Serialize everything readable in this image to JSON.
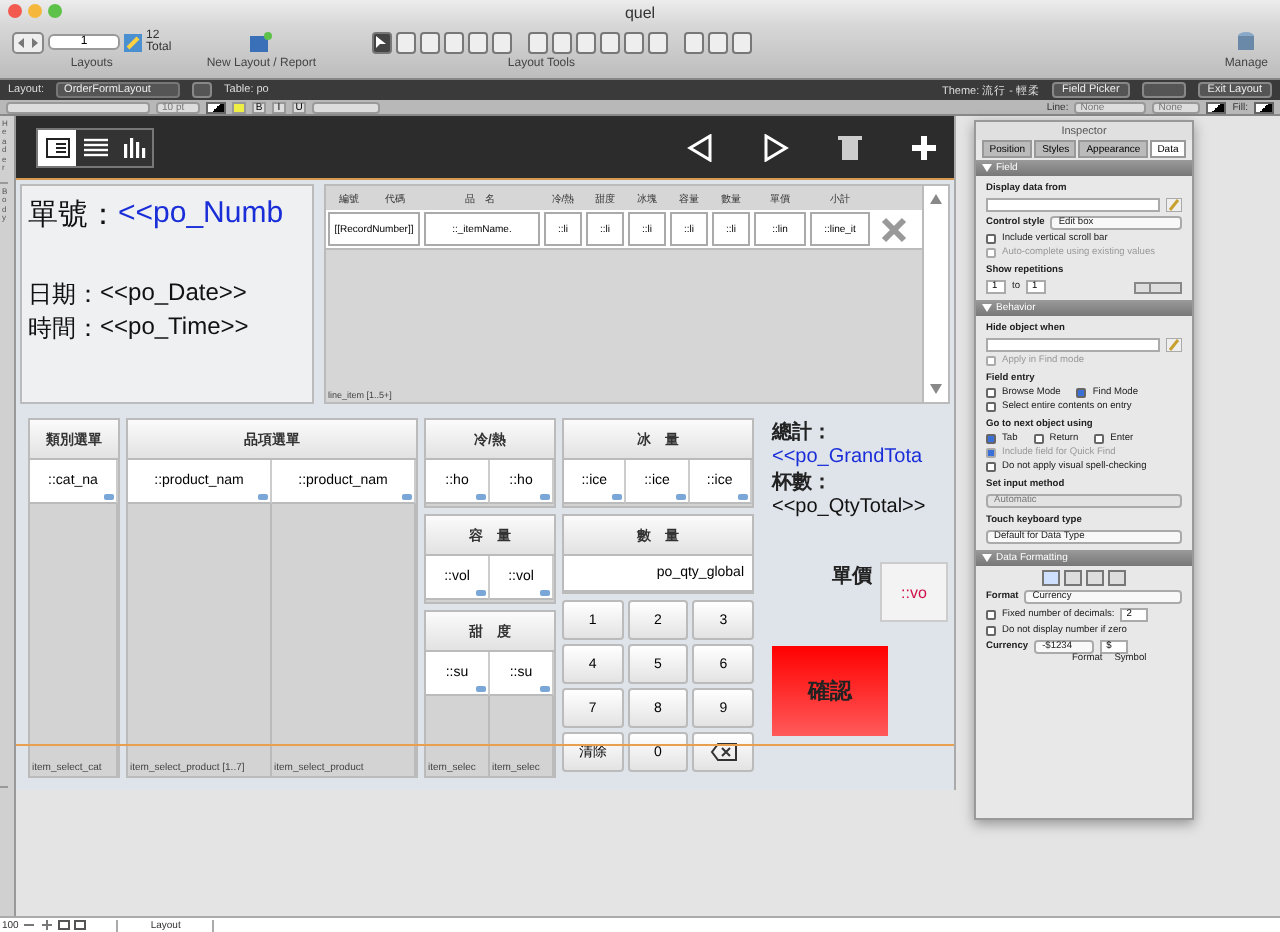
{
  "window": {
    "title": "quel"
  },
  "toolbar": {
    "record": "1",
    "total": "12",
    "total_label": "Total",
    "layouts": "Layouts",
    "new_layout": "New Layout / Report",
    "tools_label": "Layout Tools",
    "manage": "Manage"
  },
  "layout_bar": {
    "layout_label": "Layout:",
    "layout": "OrderFormLayout",
    "table": "Table: po",
    "theme": "Theme: 流行 - 輕柔",
    "field_picker": "Field Picker",
    "exit": "Exit Layout"
  },
  "format_bar": {
    "size": "10 pt",
    "styles": [
      "B",
      "I",
      "U"
    ],
    "line_label": "Line:",
    "line": "None",
    "line2": "None",
    "fill_label": "Fill:"
  },
  "parts": [
    "Header",
    "Body"
  ],
  "views": [
    {
      "kind": "form",
      "selected": true
    },
    {
      "kind": "list",
      "selected": false
    },
    {
      "kind": "table",
      "selected": false
    }
  ],
  "info": {
    "number_label": "單號：",
    "number": "<<po_Numb",
    "date_label": "日期：",
    "date": "<<po_Date>>",
    "time_label": "時間：",
    "time": "<<po_Time>>"
  },
  "portal": {
    "columns": [
      "編號",
      "代碼",
      "品　名",
      "冷/熱",
      "甜度",
      "冰塊",
      "容量",
      "數量",
      "單價",
      "小計"
    ],
    "fields": [
      "[[RecordNumber]]",
      "::_itemName.",
      "::li",
      "::li",
      "::li",
      "::li",
      "::li",
      "::lin",
      "::line_it"
    ],
    "label": "line_item [1..5+]"
  },
  "menus": [
    {
      "title": "類別選單",
      "fields": [
        "::cat_na"
      ],
      "labels": [
        "item_select_cat"
      ]
    },
    {
      "title": "品項選單",
      "fields": [
        "::product_nam",
        "::product_nam"
      ],
      "labels": [
        "item_select_product [1..7]",
        "item_select_product"
      ]
    }
  ],
  "options": [
    {
      "title": "冷/熱",
      "fields": [
        "::ho",
        "::ho"
      ]
    },
    {
      "title": "容　量",
      "fields": [
        "::vol",
        "::vol"
      ]
    },
    {
      "title": "甜　度",
      "fields": [
        "::su",
        "::su"
      ],
      "labels": [
        "item_selec",
        "item_selec"
      ]
    }
  ],
  "ice": {
    "title": "冰　量",
    "fields": [
      "::ice",
      "::ice",
      "::ice"
    ]
  },
  "qty": {
    "title": "數　量",
    "field": "po_qty_global"
  },
  "keys": [
    {
      "kind": "text",
      "label": "1"
    },
    {
      "kind": "text",
      "label": "2"
    },
    {
      "kind": "text",
      "label": "3"
    },
    {
      "kind": "text",
      "label": "4"
    },
    {
      "kind": "text",
      "label": "5"
    },
    {
      "kind": "text",
      "label": "6"
    },
    {
      "kind": "text",
      "label": "7"
    },
    {
      "kind": "text",
      "label": "8"
    },
    {
      "kind": "text",
      "label": "9"
    },
    {
      "kind": "text",
      "label": "清除"
    },
    {
      "kind": "text",
      "label": "0"
    },
    {
      "kind": "backspace"
    }
  ],
  "totals": {
    "total_label": "總計：",
    "total": "<<po_GrandTota",
    "cups_label": "杯數：",
    "cups": "<<po_QtyTotal>>",
    "price_label": "單價",
    "price": "::vo",
    "confirm": "確認"
  },
  "inspector": {
    "title": "Inspector",
    "tabs": [
      {
        "label": "Position",
        "selected": false
      },
      {
        "label": "Styles",
        "selected": false
      },
      {
        "label": "Appearance",
        "selected": false
      },
      {
        "label": "Data",
        "selected": true
      }
    ],
    "rows": [
      {
        "kind": "section",
        "text": "Field"
      },
      {
        "kind": "label",
        "text": "Display data from"
      },
      {
        "kind": "field"
      },
      {
        "kind": "select",
        "text": "Control style",
        "value": "Edit box"
      },
      {
        "kind": "check",
        "text": "Include vertical scroll bar",
        "checked": false,
        "disabled": false
      },
      {
        "kind": "check",
        "text": "Auto-complete using existing values",
        "checked": false,
        "disabled": true
      },
      {
        "kind": "label",
        "text": "Show repetitions"
      },
      {
        "kind": "reps",
        "from": "1",
        "to_label": "to",
        "to": "1"
      },
      {
        "kind": "section",
        "text": "Behavior"
      },
      {
        "kind": "label",
        "text": "Hide object when"
      },
      {
        "kind": "field"
      },
      {
        "kind": "check",
        "text": "Apply in Find mode",
        "checked": false,
        "disabled": true
      },
      {
        "kind": "label",
        "text": "Field entry"
      },
      {
        "kind": "checks",
        "items": [
          {
            "text": "Browse Mode",
            "checked": false
          },
          {
            "text": "Find Mode",
            "checked": true
          }
        ]
      },
      {
        "kind": "check",
        "text": "Select entire contents on entry",
        "checked": false,
        "disabled": false
      },
      {
        "kind": "label",
        "text": "Go to next object using"
      },
      {
        "kind": "checks",
        "items": [
          {
            "text": "Tab",
            "checked": true
          },
          {
            "text": "Return",
            "checked": false
          },
          {
            "text": "Enter",
            "checked": false
          }
        ]
      },
      {
        "kind": "check",
        "text": "Include field for Quick Find",
        "checked": true,
        "disabled": true
      },
      {
        "kind": "check",
        "text": "Do not apply visual spell-checking",
        "checked": false,
        "disabled": false
      },
      {
        "kind": "label",
        "text": "Set input method"
      },
      {
        "kind": "select",
        "value": "Automatic",
        "disabled": true
      },
      {
        "kind": "label",
        "text": "Touch keyboard type"
      },
      {
        "kind": "select",
        "value": "Default for Data Type",
        "disabled": false
      },
      {
        "kind": "section",
        "text": "Data Formatting"
      },
      {
        "kind": "icons"
      },
      {
        "kind": "select",
        "text": "Format",
        "value": "Currency",
        "disabled": false
      },
      {
        "kind": "decimals",
        "text": "Fixed number of decimals:",
        "value": "2",
        "checked": false
      },
      {
        "kind": "check",
        "text": "Do not display number if zero",
        "checked": false,
        "disabled": false
      },
      {
        "kind": "currency",
        "text": "Currency",
        "value": "-$1234",
        "symbol": "$",
        "format_label": "Format",
        "symbol_label": "Symbol"
      }
    ]
  },
  "status": {
    "zoom": "100",
    "mode": "Layout"
  }
}
